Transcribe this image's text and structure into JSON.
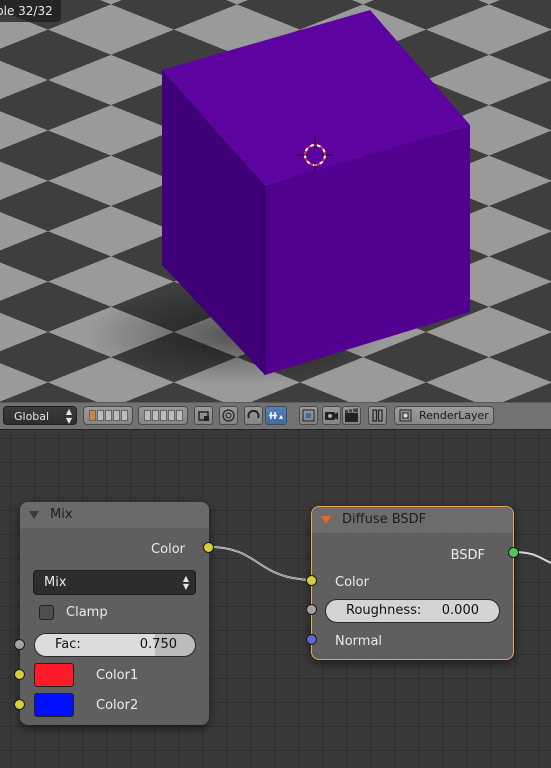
{
  "viewport": {
    "status_text": "ple 32/32",
    "object": "cube",
    "cube_color": "#5a009c",
    "floor_light": "#bdbdbd",
    "floor_dark": "#555555"
  },
  "header": {
    "orientation_label": "Global",
    "render_layer_label": "RenderLayer"
  },
  "node_editor": {
    "mix_node": {
      "title": "Mix",
      "output_color_label": "Color",
      "blend_type": "Mix",
      "clamp_label": "Clamp",
      "fac_label": "Fac:",
      "fac_value": "0.750",
      "fac_fraction": 0.75,
      "color1_label": "Color1",
      "color1_value": "#ff1a2a",
      "color2_label": "Color2",
      "color2_value": "#0010ff"
    },
    "diffuse_node": {
      "title": "Diffuse BSDF",
      "output_label": "BSDF",
      "color_label": "Color",
      "roughness_label": "Roughness:",
      "roughness_value": "0.000",
      "normal_label": "Normal"
    }
  },
  "colors": {
    "socket_color": "#d8cd3b",
    "socket_float": "#a2a2a2",
    "socket_shader": "#56c45a",
    "socket_vector": "#6464cc",
    "selection_outline": "#e8a54a"
  }
}
